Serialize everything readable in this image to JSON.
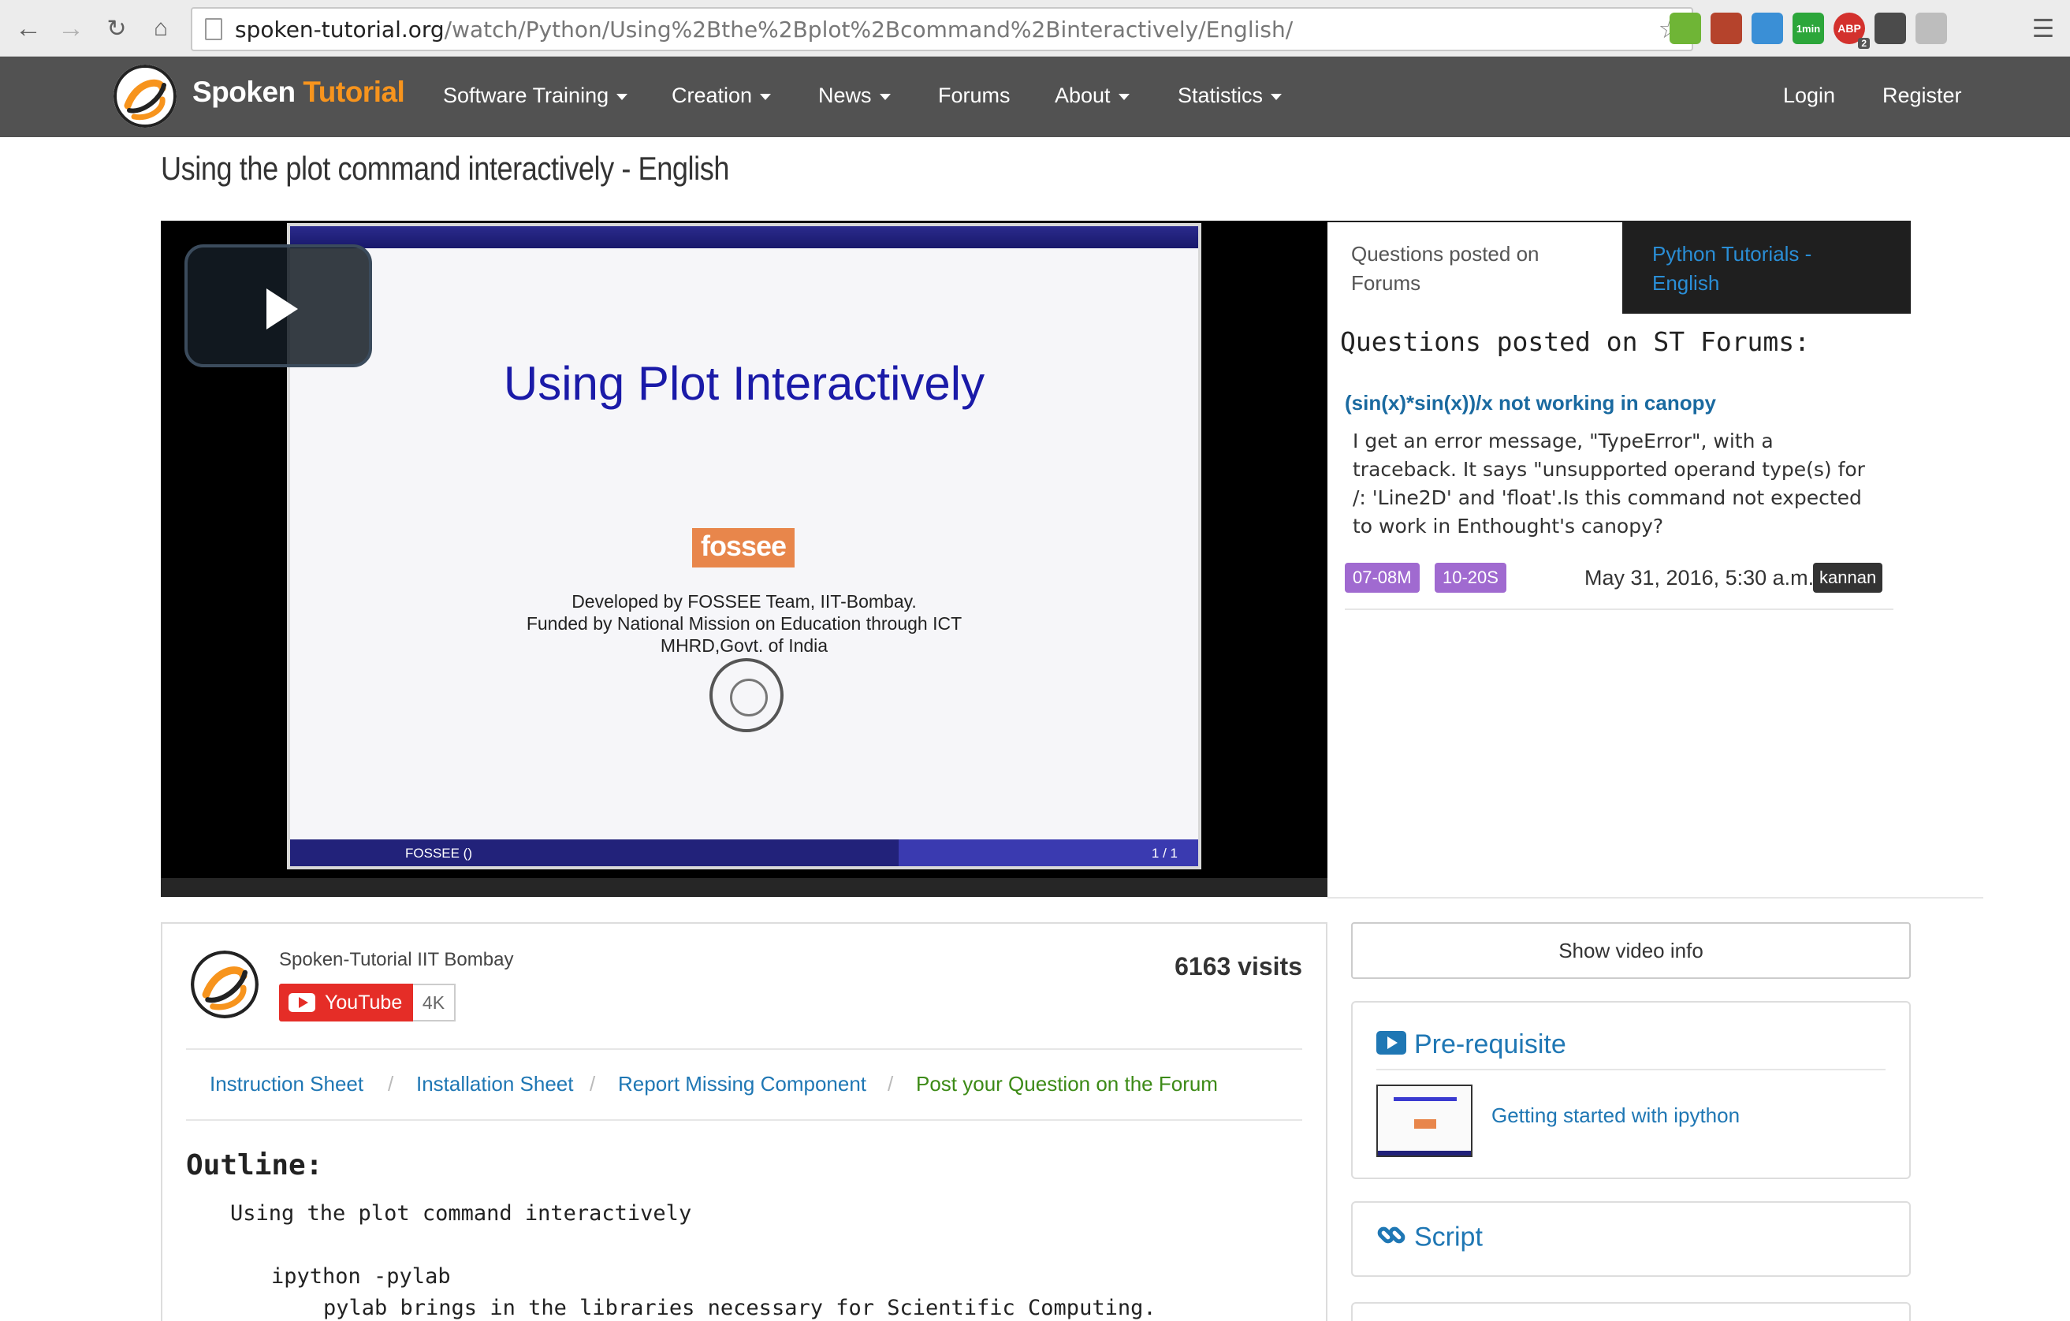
{
  "browser": {
    "url_host": "spoken-tutorial.org",
    "url_path": "/watch/Python/Using%2Bthe%2Bplot%2Bcommand%2Binteractively/English/",
    "extensions": [
      {
        "name": "evernote-icon",
        "color": "#6fb536",
        "label": ""
      },
      {
        "name": "puzzle-icon",
        "color": "#b5432c",
        "label": ""
      },
      {
        "name": "window-icon",
        "color": "#3a8fd6",
        "label": ""
      },
      {
        "name": "1min-icon",
        "color": "#2ca63a",
        "label": "1min"
      },
      {
        "name": "adblock-icon",
        "color": "#d3312d",
        "label": "ABP"
      },
      {
        "name": "shield-icon",
        "color": "#4b4b4b",
        "label": ""
      },
      {
        "name": "settings-icon",
        "color": "#bdbdbd",
        "label": ""
      }
    ],
    "adblock_badge": "2"
  },
  "navbar": {
    "brand_first": "Spoken",
    "brand_second": "Tutorial",
    "items": [
      "Software Training",
      "Creation",
      "News",
      "Forums",
      "About",
      "Statistics"
    ],
    "login": "Login",
    "register": "Register"
  },
  "page": {
    "title": "Using the plot command interactively - English"
  },
  "video": {
    "slide_title": "Using Plot Interactively",
    "fossee_logo_text": "fossee",
    "credits": [
      "Developed by FOSSEE Team, IIT-Bombay.",
      "Funded by National Mission on Education through ICT",
      "MHRD,Govt. of India"
    ],
    "footer_left": "FOSSEE ()",
    "footer_right": "1 / 1"
  },
  "side_tabs": {
    "active": "Questions posted on Forums",
    "other": "Python Tutorials - English"
  },
  "forum": {
    "heading": "Questions posted on ST Forums:",
    "question": {
      "title": "(sin(x)*sin(x))/x not working in canopy",
      "body": "I get an error message, \"TypeError\", with a traceback.  It says \"unsupported operand type(s) for /: 'Line2D' and 'float'.Is this command not expected to work in Enthought's canopy?",
      "tags": [
        "07-08M",
        "10-20S"
      ],
      "date": "May 31, 2016, 5:30 a.m.",
      "user": "kannan"
    }
  },
  "channel": {
    "name": "Spoken-Tutorial IIT Bombay",
    "youtube_label": "YouTube",
    "subscriber_count": "4K",
    "visits": "6163 visits"
  },
  "links": {
    "instruction": "Instruction Sheet",
    "installation": "Installation Sheet",
    "report": "Report Missing Component",
    "post_question": "Post your Question on the Forum",
    "separator": "/"
  },
  "outline": {
    "heading": "Outline:",
    "line1": "Using the plot command interactively",
    "line2": "ipython -pylab",
    "line3": "pylab brings in the libraries necessary for Scientific Computing."
  },
  "right": {
    "show_info": "Show video info",
    "prerequisite_heading": "Pre-requisite",
    "prerequisite_link": "Getting started with ipython",
    "script_heading": "Script"
  }
}
